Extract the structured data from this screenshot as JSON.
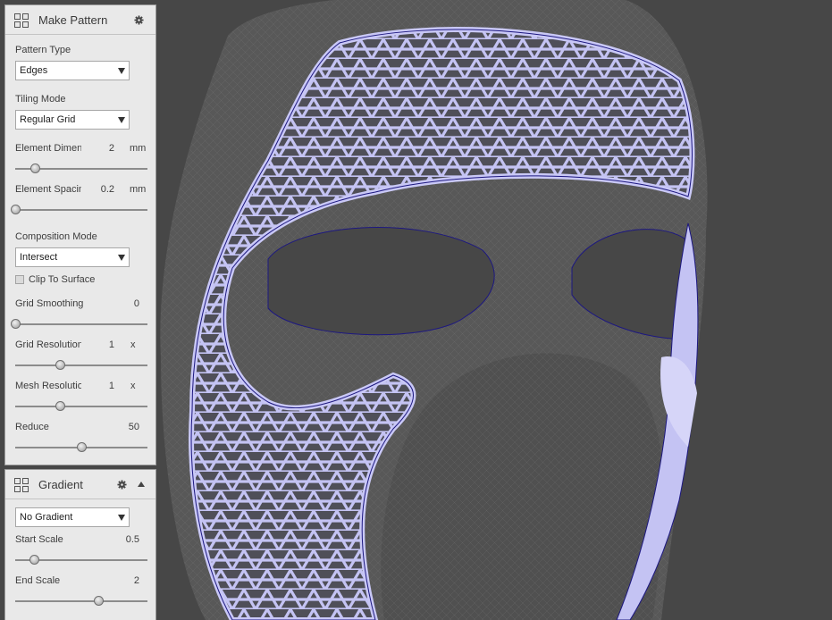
{
  "make_pattern": {
    "title": "Make Pattern",
    "title_icon": "grid-icon",
    "settings_icon": "gear-icon",
    "pattern_type": {
      "label": "Pattern Type",
      "value": "Edges"
    },
    "tiling_mode": {
      "label": "Tiling Mode",
      "value": "Regular Grid"
    },
    "element_dimension": {
      "label": "Element Dimension",
      "value": "2",
      "unit": "mm",
      "slider_level": 0.15
    },
    "element_spacing": {
      "label": "Element Spacing",
      "value": "0.2",
      "unit": "mm",
      "slider_level": 0.0
    },
    "composition_mode": {
      "label": "Composition Mode",
      "value": "Intersect"
    },
    "clip_to_surface": {
      "label": "Clip To Surface",
      "checked": false
    },
    "grid_smoothing": {
      "label": "Grid Smoothing",
      "value": "0",
      "slider_level": 0.0
    },
    "grid_resolution": {
      "label": "Grid Resolution",
      "value": "1",
      "unit": "x",
      "slider_level": 0.34
    },
    "mesh_resolution": {
      "label": "Mesh Resolution",
      "value": "1",
      "unit": "x",
      "slider_level": 0.34
    },
    "reduce": {
      "label": "Reduce",
      "value": "50",
      "slider_level": 0.5
    }
  },
  "gradient": {
    "title": "Gradient",
    "title_icon": "grid-icon",
    "settings_icon": "gear-icon",
    "collapse_icon": "chevron-up-icon",
    "mode": {
      "value": "No Gradient"
    },
    "start_scale": {
      "label": "Start Scale",
      "value": "0.5",
      "slider_level": 0.14
    },
    "end_scale": {
      "label": "End Scale",
      "value": "2",
      "slider_level": 0.63
    }
  },
  "colors": {
    "background": "#474747",
    "panel": "#e9e9e9",
    "mesh": "#5c5c5c",
    "pattern": "#b7b6ec",
    "outline": "#1d1880"
  }
}
